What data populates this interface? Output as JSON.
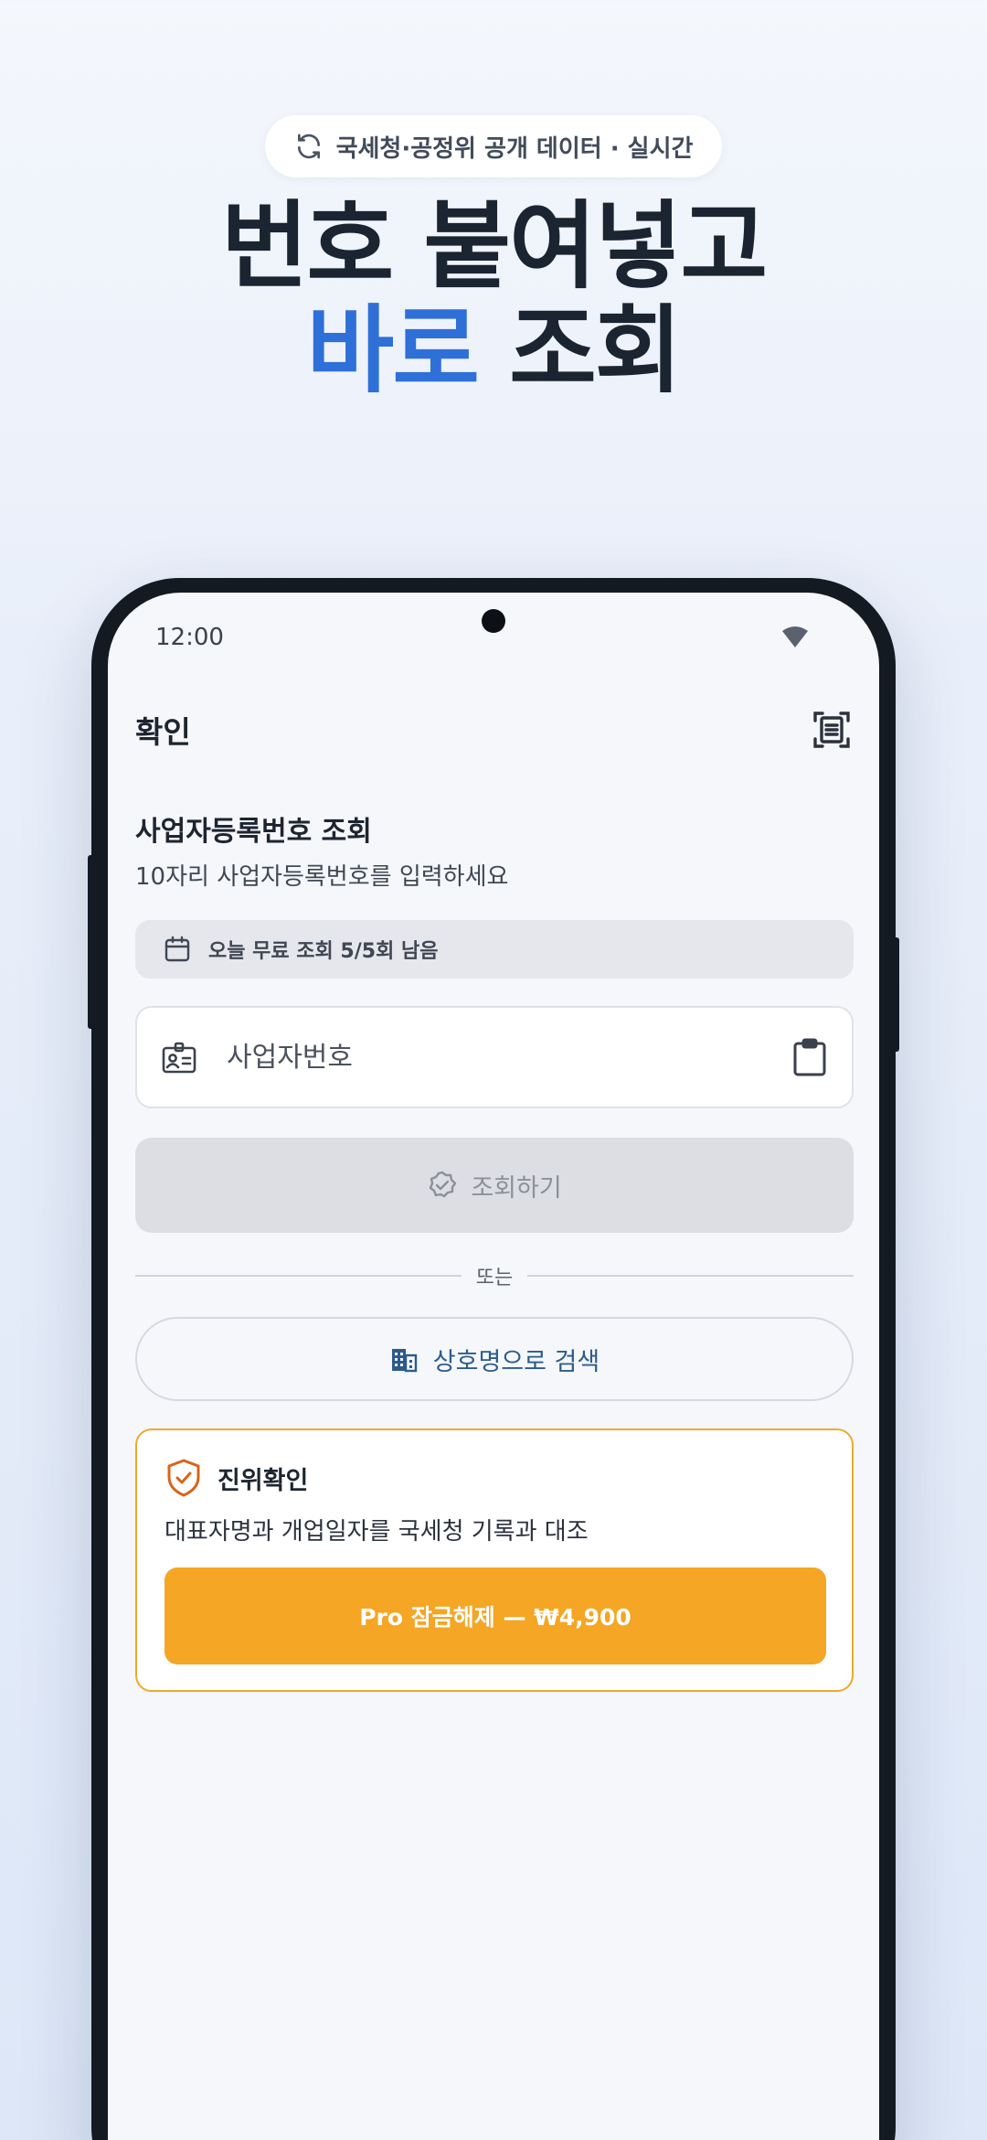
{
  "promo": {
    "pill_text": "국세청·공정위 공개 데이터 · 실시간",
    "headline_line1": "번호 붙여넣고",
    "headline_accent": "바로",
    "headline_line2_rest": " 조회"
  },
  "status_bar": {
    "time": "12:00"
  },
  "app_bar": {
    "title": "확인"
  },
  "lookup": {
    "title": "사업자등록번호 조회",
    "subtitle": "10자리 사업자등록번호를 입력하세요",
    "quota_text": "오늘 무료 조회 5/5회 남음",
    "input_placeholder": "사업자번호",
    "submit_label": "조회하기",
    "divider_text": "또는",
    "name_search_label": "상호명으로 검색"
  },
  "pro_card": {
    "title": "진위확인",
    "description": "대표자명과 개업일자를 국세청 기록과 대조",
    "button_label": "Pro 잠금해제 — ₩4,900"
  },
  "colors": {
    "accent_blue": "#2f6fd8",
    "pro_orange": "#f4a624",
    "headline": "#1b2431"
  },
  "icons": {
    "pill": "refresh-icon",
    "app_bar": "scan-document-icon",
    "quota": "calendar-icon",
    "input_leading": "id-card-icon",
    "input_trailing": "clipboard-icon",
    "submit": "verified-badge-icon",
    "name_search": "building-icon",
    "pro": "shield-check-icon"
  }
}
